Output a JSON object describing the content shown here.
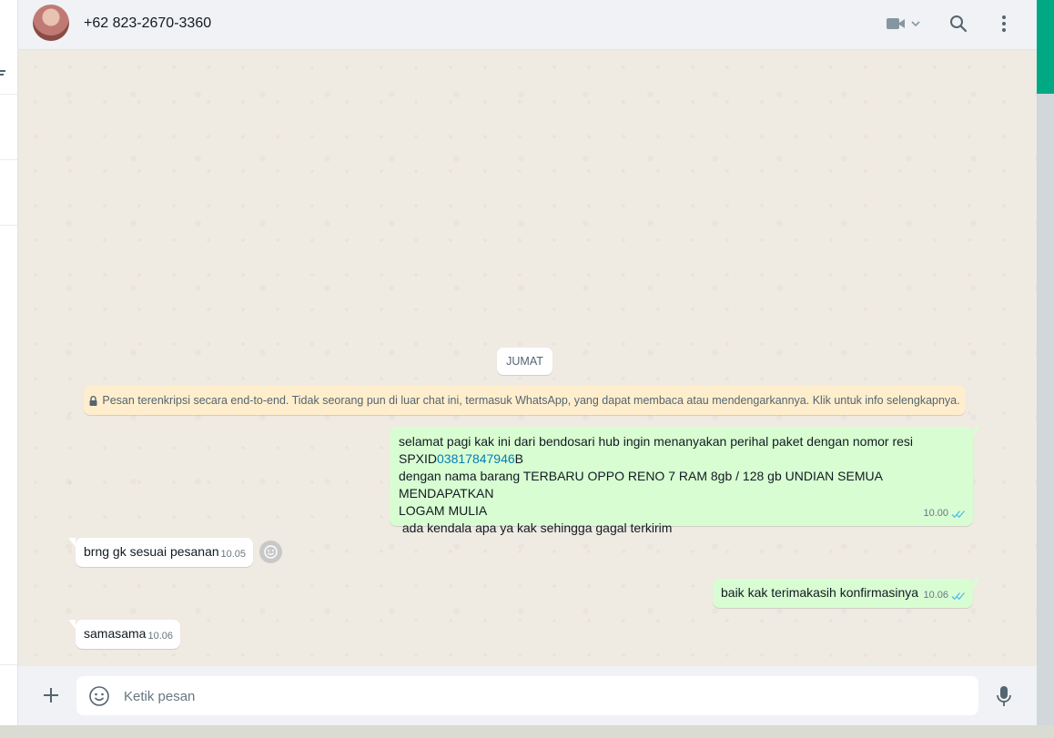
{
  "header": {
    "contact_name": "+62 823-2670-3360",
    "icons": [
      "video-call-icon",
      "chevron-down-icon",
      "search-icon",
      "menu-dots-icon"
    ]
  },
  "chat": {
    "date_label": "JUMAT",
    "e2e_notice": "Pesan terenkripsi secara end-to-end. Tidak seorang pun di luar chat ini, termasuk WhatsApp, yang dapat membaca atau mendengarkannya. Klik untuk info selengkapnya.",
    "messages": [
      {
        "direction": "out",
        "line1": "selamat pagi kak ini dari bendosari hub ingin menanyakan perihal paket dengan nomor resi",
        "resi_prefix": "SPXID",
        "resi_number": "03817847946",
        "resi_suffix": "B",
        "line3": "dengan nama barang TERBARU OPPO RENO 7 RAM 8gb / 128 gb UNDIAN SEMUA MENDAPATKAN",
        "line4": "LOGAM MULIA",
        "line5": " ada kendala apa ya kak sehingga gagal terkirim",
        "time": "10.00",
        "status": "read"
      },
      {
        "direction": "in",
        "text": "brng gk sesuai pesanan",
        "time": "10.05"
      },
      {
        "direction": "out",
        "text": "baik kak terimakasih konfirmasinya",
        "time": "10.06",
        "status": "read"
      },
      {
        "direction": "in",
        "text": "samasama",
        "time": "10.06"
      }
    ]
  },
  "footer": {
    "input_placeholder": "Ketik pesan",
    "input_value": ""
  },
  "colors": {
    "accent": "#00a884",
    "outgoing_bubble": "#d9fdd3",
    "incoming_bubble": "#ffffff",
    "notice": "#ffeecd",
    "read_ticks": "#53bdeb",
    "link": "#027eb5"
  }
}
